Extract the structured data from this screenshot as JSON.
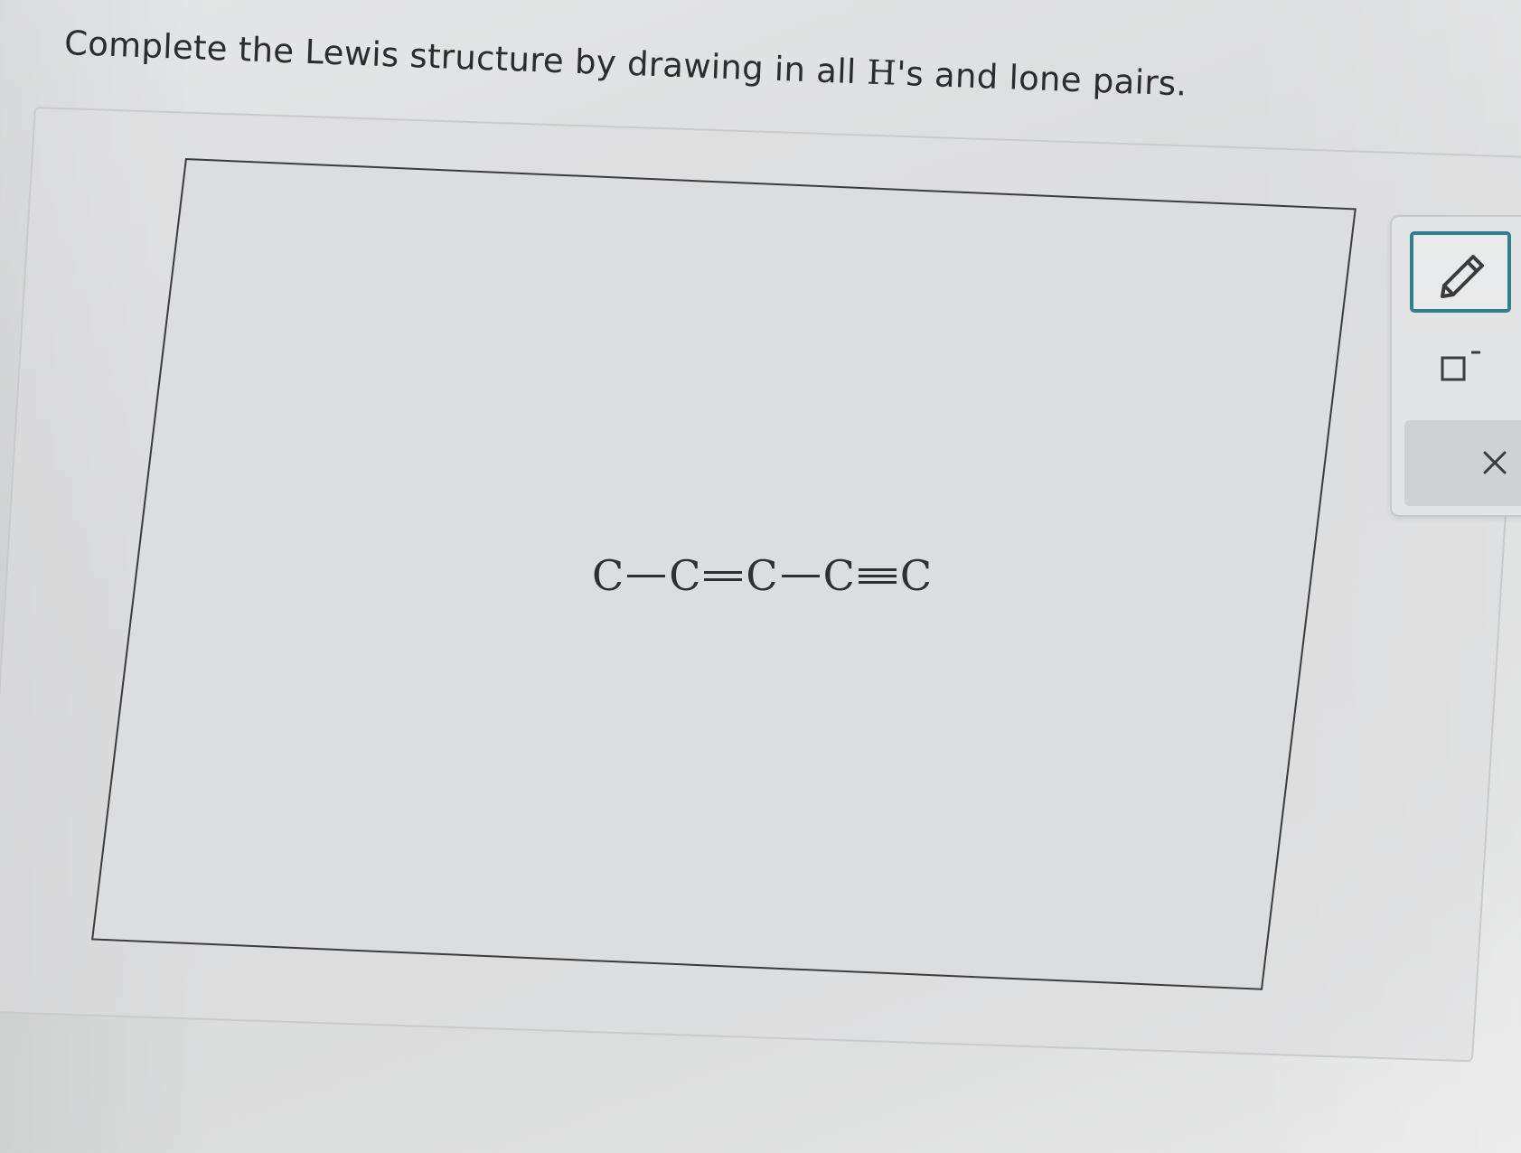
{
  "question": {
    "text_before": "Complete the Lewis structure by drawing in all ",
    "text_serif": "H",
    "text_after": "'s and lone pairs."
  },
  "molecule": {
    "atoms": [
      "C",
      "C",
      "C",
      "C",
      "C"
    ],
    "bonds": [
      "single",
      "double",
      "single",
      "triple"
    ]
  },
  "toolbar": {
    "tools": [
      {
        "name": "pencil",
        "icon": "pencil-icon",
        "selected": true
      },
      {
        "name": "charge",
        "icon": "charge-box-icon",
        "selected": false
      },
      {
        "name": "delete",
        "icon": "close-icon",
        "selected": false
      }
    ]
  },
  "colors": {
    "accent": "#2f7f8c",
    "canvas_border": "#3a3b40",
    "text": "#2b2c2e"
  }
}
